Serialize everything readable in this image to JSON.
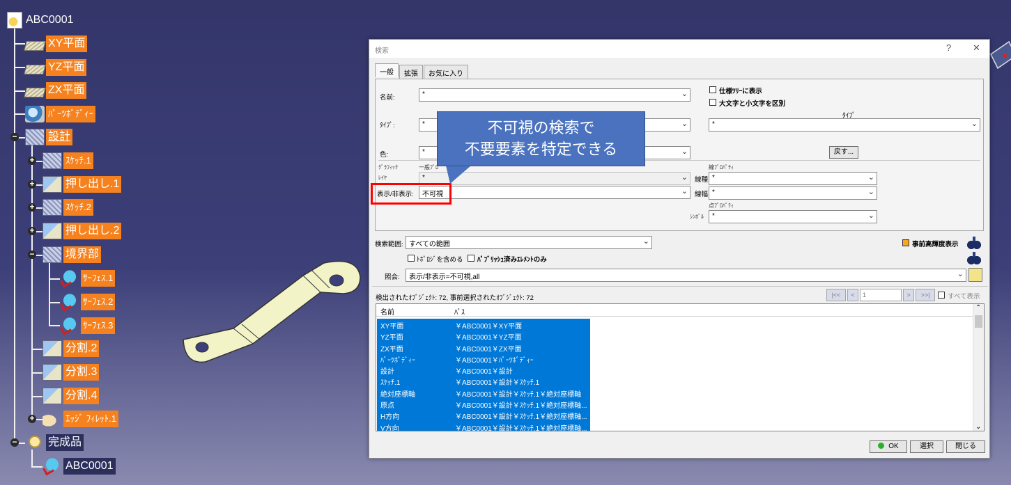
{
  "tree": {
    "root": "ABC0001",
    "items": [
      {
        "label": "XY平面"
      },
      {
        "label": "YZ平面"
      },
      {
        "label": "ZX平面"
      },
      {
        "label": "ﾊﾟｰﾂﾎﾞﾃﾞｨｰ"
      },
      {
        "label": "設計"
      },
      {
        "label": "ｽｹｯﾁ.1"
      },
      {
        "label": "押し出し.1"
      },
      {
        "label": "ｽｹｯﾁ.2"
      },
      {
        "label": "押し出し.2"
      },
      {
        "label": "境界部"
      },
      {
        "label": "ｻｰﾌｪｽ.1"
      },
      {
        "label": "ｻｰﾌｪｽ.2"
      },
      {
        "label": "ｻｰﾌｪｽ.3"
      },
      {
        "label": "分割.2"
      },
      {
        "label": "分割.3"
      },
      {
        "label": "分割.4"
      },
      {
        "label": "ｴｯｼﾞ ﾌｨﾚｯﾄ.1"
      },
      {
        "label": "完成品"
      },
      {
        "label": "ABC0001"
      }
    ]
  },
  "dialog": {
    "title": "検索",
    "help": "?",
    "close": "✕",
    "tabs": [
      "一般",
      "拡張",
      "お気に入り"
    ],
    "name_label": "名前:",
    "name_value": "*",
    "type_label": "ﾀｲﾌﾟ:",
    "type_value": "*",
    "color_label": "色:",
    "color_value": "*",
    "cb_spec_tree": "仕様ﾂﾘｰに表示",
    "cb_case": "大文字と小文字を区別",
    "type_right_label": "ﾀｲﾌﾟ",
    "type_right_value": "*",
    "back_button": "戻す...",
    "graphic_label": "ｸﾞﾗﾌｨｯｸ",
    "general_prop_label": "一般ﾌﾟﾛ",
    "layer_label": "ﾚｲﾔ",
    "layer_value": "*",
    "show_hide_label": "表示/非表示:",
    "show_hide_value": "不可視",
    "line_prop_label": "線ﾌﾟﾛﾊﾟﾃｨ",
    "line_type_label": "線種",
    "line_type_value": "*",
    "line_width_label": "線幅",
    "line_width_value": "*",
    "point_prop_label": "点ﾌﾟﾛﾊﾟﾃｨ",
    "symbol_label": "ｼﾝﾎﾞﾙ",
    "symbol_value": "*",
    "scope_label": "検索範囲:",
    "scope_value": "すべての範囲",
    "pre_highlight": "事前高輝度表示",
    "cb_topology": "ﾄﾎﾟﾛｼﾞを含める",
    "cb_published": "ﾊﾟﾌﾞﾘｯｼｭ済みｴﾚﾒﾝﾄのみ",
    "query_label": "照会:",
    "query_value": "表示/非表示=不可視,all",
    "found_text": "検出されたｵﾌﾞｼﾞｪｸﾄ: 72, 事前選択されたｵﾌﾞｼﾞｪｸﾄ: 72",
    "pager": {
      "first": "|<<",
      "prev": "<",
      "page": "1",
      "next": ">",
      "last": ">>|",
      "show_all": "すべて表示"
    },
    "columns": [
      "名前",
      "ﾊﾟｽ"
    ],
    "rows": [
      {
        "name": "XY平面",
        "path": "￥ABC0001￥XY平面"
      },
      {
        "name": "YZ平面",
        "path": "￥ABC0001￥YZ平面"
      },
      {
        "name": "ZX平面",
        "path": "￥ABC0001￥ZX平面"
      },
      {
        "name": "ﾊﾟｰﾂﾎﾞﾃﾞｨｰ",
        "path": "￥ABC0001￥ﾊﾟｰﾂﾎﾞﾃﾞｨｰ"
      },
      {
        "name": "設計",
        "path": "￥ABC0001￥設計"
      },
      {
        "name": "ｽｹｯﾁ.1",
        "path": "￥ABC0001￥設計￥ｽｹｯﾁ.1"
      },
      {
        "name": "絶対座標軸",
        "path": "￥ABC0001￥設計￥ｽｹｯﾁ.1￥絶対座標軸"
      },
      {
        "name": "原点",
        "path": "￥ABC0001￥設計￥ｽｹｯﾁ.1￥絶対座標軸..."
      },
      {
        "name": "H方向",
        "path": "￥ABC0001￥設計￥ｽｹｯﾁ.1￥絶対座標軸..."
      },
      {
        "name": "V方向",
        "path": "￥ABC0001￥設計￥ｽｹｯﾁ.1￥絶対座標軸..."
      }
    ],
    "ok": "OK",
    "select": "選択",
    "close_btn": "閉じる"
  },
  "callout": {
    "line1": "不可視の検索で",
    "line2": "不要要素を特定できる"
  },
  "colors": {
    "tree_label_bg": "#f5821f",
    "selection": "#0078d7",
    "callout": "#4a72bf",
    "highlight_box": "#ff0000"
  }
}
